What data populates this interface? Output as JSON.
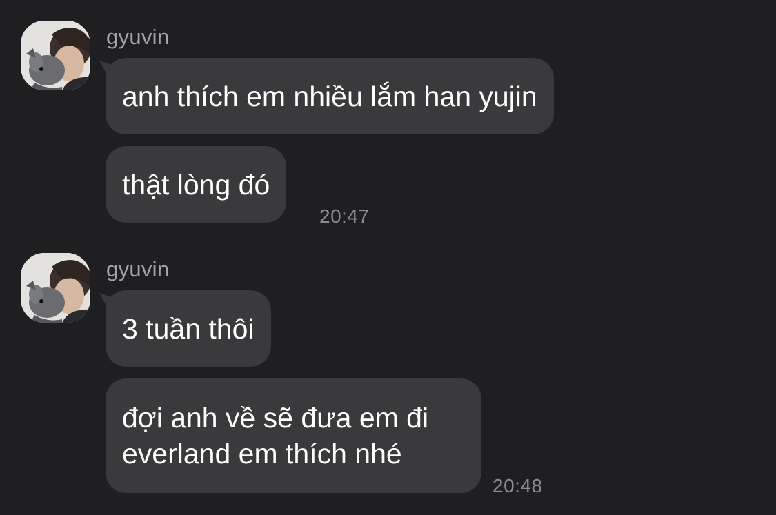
{
  "conversation": {
    "groups": [
      {
        "sender": "gyuvin",
        "avatar_icon": "user-avatar-photo",
        "messages": [
          {
            "text": "anh thích em nhiều lắm han yujin"
          },
          {
            "text": "thật lòng đó"
          }
        ],
        "time": "20:47"
      },
      {
        "sender": "gyuvin",
        "avatar_icon": "user-avatar-photo",
        "messages": [
          {
            "text": "3 tuần thôi"
          },
          {
            "text": "đợi anh về sẽ đưa em đi everland em thích nhé"
          }
        ],
        "time": "20:48"
      }
    ]
  },
  "colors": {
    "background": "#1f1f21",
    "bubble": "#3a3a3c",
    "text": "#ffffff",
    "meta_text": "#8c8c90"
  }
}
